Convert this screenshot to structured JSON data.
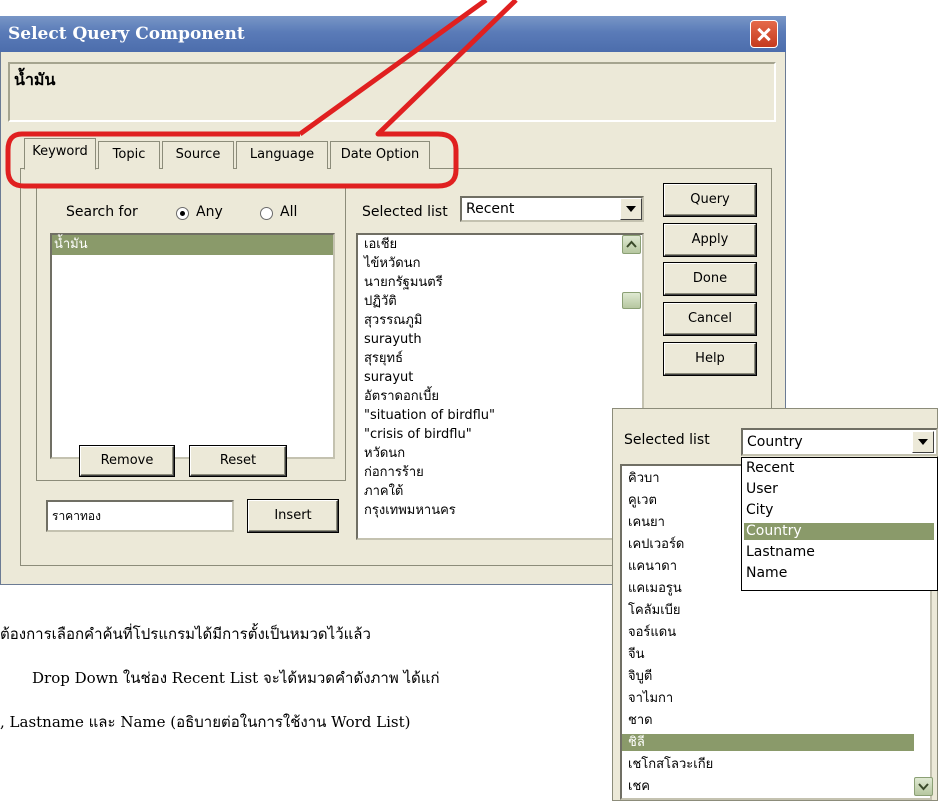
{
  "dialog": {
    "title": "Select Query Component",
    "query_text": "น้ำมัน",
    "tabs": [
      "Keyword",
      "Topic",
      "Source",
      "Language",
      "Date Option"
    ],
    "active_tab": "Keyword",
    "search": {
      "label": "Search for",
      "option_any": "Any",
      "option_all": "All",
      "selected_option": "Any",
      "items": [
        "น้ำมัน"
      ],
      "remove_label": "Remove",
      "reset_label": "Reset",
      "insert_value": "ราคาทอง",
      "insert_label": "Insert"
    },
    "selected_list": {
      "label": "Selected list",
      "value": "Recent",
      "items": [
        "เอเชีย",
        "ไข้หวัดนก",
        "นายกรัฐมนตรี",
        "ปฏิวัติ",
        "สุวรรณภูมิ",
        "surayuth",
        "สุรยุทธ์",
        "surayut",
        "อัตราดอกเบี้ย",
        "\"situation of birdflu\"",
        "\"crisis of birdflu\"",
        "หวัดนก",
        "ก่อการร้าย",
        "ภาคใต้",
        "กรุงเทพมหานคร"
      ]
    },
    "buttons": [
      "Query",
      "Apply",
      "Done",
      "Cancel",
      "Help"
    ]
  },
  "overlay": {
    "label": "Selected list",
    "value": "Country",
    "dropdown_options": [
      "Recent",
      "User",
      "City",
      "Country",
      "Lastname",
      "Name"
    ],
    "highlighted_option": "Country",
    "items": [
      "คิวบา",
      "คูเวต",
      "เคนยา",
      "เคปเวอร์ด",
      "แคนาดา",
      "แคเมอรูน",
      "โคลัมเบีย",
      "จอร์แดน",
      "จีน",
      "จิบูตี",
      "จาไมกา",
      "ชาด",
      "ชิลี",
      "เชโกสโลวะเกีย",
      "เชค"
    ],
    "highlighted_item": "ชิลี"
  },
  "instructions": {
    "line1": "ต้องการเลือกคำค้นที่โปรแกรมได้มีการตั้งเป็นหมวดไว้แล้ว",
    "line2": "Drop Down ในช่อง Recent List จะได้หมวดคำดังภาพ ได้แก่",
    "line3": ", Lastname และ Name (อธิบายต่อในการใช้งาน Word List)"
  },
  "colors": {
    "titlebar": "#5a7bb8",
    "face": "#ece9d8",
    "callout": "#e02020",
    "selection": "#8a9a6a"
  }
}
